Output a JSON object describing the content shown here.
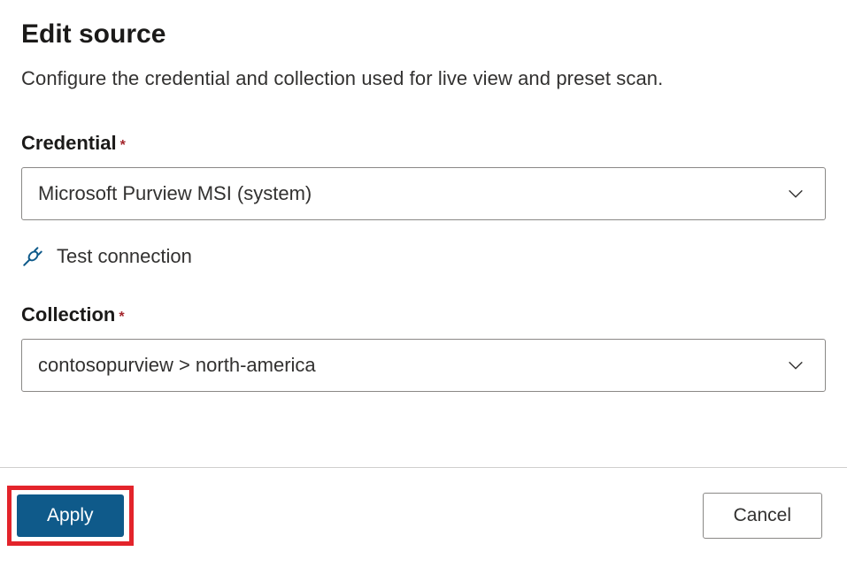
{
  "header": {
    "title": "Edit source",
    "description": "Configure the credential and collection used for live view and preset scan."
  },
  "credential": {
    "label": "Credential",
    "required_mark": "*",
    "selected": "Microsoft Purview MSI (system)"
  },
  "test_connection": {
    "label": "Test connection"
  },
  "collection": {
    "label": "Collection",
    "required_mark": "*",
    "selected": "contosopurview > north-america"
  },
  "footer": {
    "apply_label": "Apply",
    "cancel_label": "Cancel"
  }
}
